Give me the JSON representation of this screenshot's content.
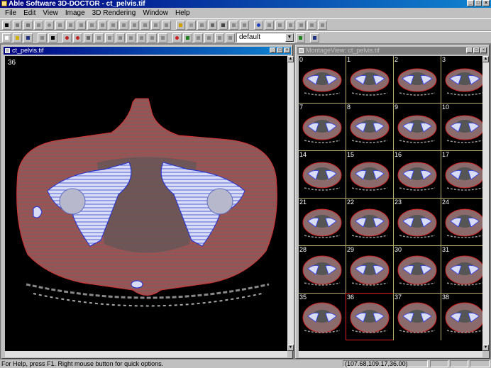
{
  "app": {
    "title": "Able Software 3D-DOCTOR - ct_pelvis.tif"
  },
  "menu": [
    "File",
    "Edit",
    "View",
    "Image",
    "3D Rendering",
    "Window",
    "Help"
  ],
  "toolbar2": {
    "combo_value": "default"
  },
  "image_window": {
    "title": "ct_pelvis.tif",
    "slice_number": "36"
  },
  "montage_window": {
    "title": "MontageView: ct_pelvis.tif",
    "tiles": [
      "0",
      "1",
      "2",
      "3",
      "7",
      "8",
      "9",
      "10",
      "14",
      "15",
      "16",
      "17",
      "21",
      "22",
      "23",
      "24",
      "28",
      "29",
      "30",
      "31",
      "35",
      "36",
      "37",
      "38"
    ],
    "selected_tile": "36"
  },
  "status": {
    "help": "For Help, press F1. Right mouse button for quick options.",
    "coords": "(107.68,109.17,36.00)"
  },
  "colors": {
    "contour_red": "#d02020",
    "contour_blue": "#3040ff",
    "title_active": "#000080"
  }
}
